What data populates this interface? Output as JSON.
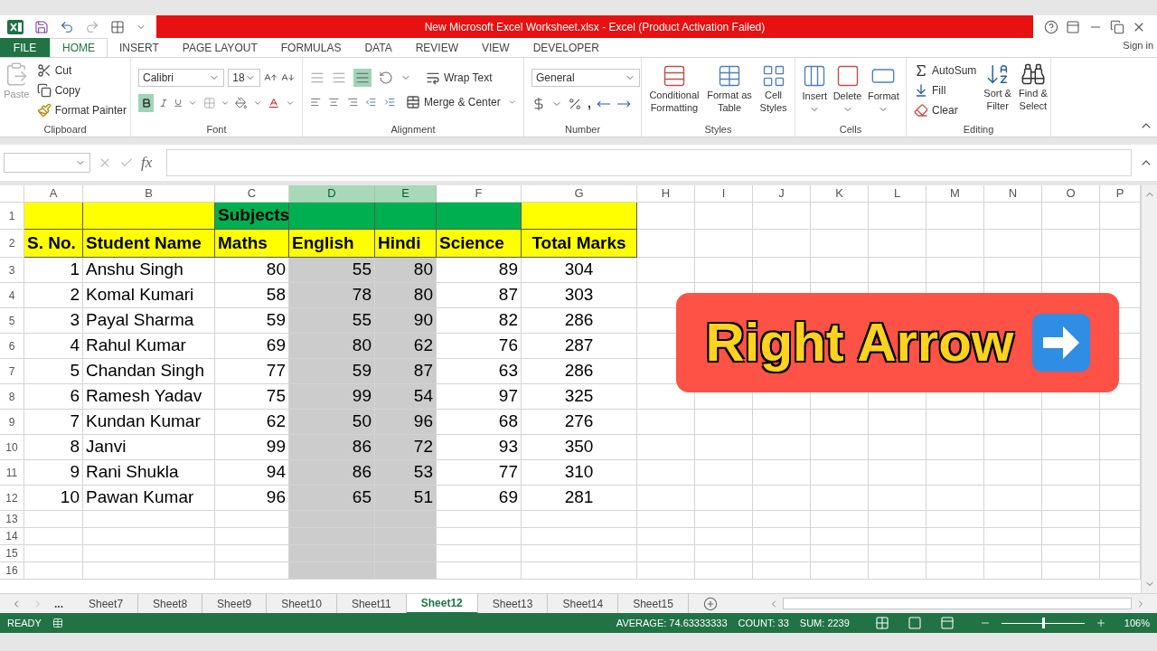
{
  "title_bar": {
    "title": "New Microsoft Excel Worksheet.xlsx -  Excel (Product Activation Failed)"
  },
  "ribbon_tabs": [
    {
      "label": "FILE",
      "kind": "file",
      "selected": false
    },
    {
      "label": "HOME",
      "kind": "tab",
      "selected": true
    },
    {
      "label": "INSERT",
      "kind": "tab",
      "selected": false
    },
    {
      "label": "PAGE LAYOUT",
      "kind": "tab",
      "selected": false
    },
    {
      "label": "FORMULAS",
      "kind": "tab",
      "selected": false
    },
    {
      "label": "DATA",
      "kind": "tab",
      "selected": false
    },
    {
      "label": "REVIEW",
      "kind": "tab",
      "selected": false
    },
    {
      "label": "VIEW",
      "kind": "tab",
      "selected": false
    },
    {
      "label": "DEVELOPER",
      "kind": "tab",
      "selected": false
    }
  ],
  "sign_in": "Sign in",
  "clipboard": {
    "label": "Clipboard",
    "paste": "Paste",
    "cut": "Cut",
    "copy": "Copy",
    "format_painter": "Format Painter"
  },
  "font": {
    "label": "Font",
    "font_name": "Calibri",
    "font_size": "18",
    "bold": true
  },
  "alignment": {
    "label": "Alignment",
    "wrap_text": "Wrap Text",
    "merge": "Merge & Center",
    "bottom_align": true
  },
  "number": {
    "label": "Number",
    "format": "General",
    "comma": ","
  },
  "styles": {
    "label": "Styles",
    "buttons": [
      {
        "lines": [
          "Conditional",
          "Formatting"
        ],
        "kind": "conditional"
      },
      {
        "lines": [
          "Format as",
          "Table"
        ],
        "kind": "table"
      },
      {
        "lines": [
          "Cell",
          "Styles"
        ],
        "kind": "cellstyles"
      }
    ]
  },
  "cells": {
    "label": "Cells",
    "buttons": [
      {
        "label": "Insert",
        "kind": "insert"
      },
      {
        "label": "Delete",
        "kind": "delete"
      },
      {
        "label": "Format",
        "kind": "format"
      }
    ]
  },
  "editing": {
    "label": "Editing",
    "autosum": "AutoSum",
    "fill": "Fill",
    "clear": "Clear",
    "sort": [
      "Sort &",
      "Filter"
    ],
    "find": [
      "Find &",
      "Select"
    ]
  },
  "formula_bar": {
    "fx": "fx"
  },
  "columns": [
    {
      "letter": "A",
      "selected": false
    },
    {
      "letter": "B",
      "selected": false
    },
    {
      "letter": "C",
      "selected": false
    },
    {
      "letter": "D",
      "selected": true
    },
    {
      "letter": "E",
      "selected": true
    },
    {
      "letter": "F",
      "selected": false
    },
    {
      "letter": "G",
      "selected": false
    },
    {
      "letter": "H",
      "selected": false
    },
    {
      "letter": "I",
      "selected": false
    },
    {
      "letter": "J",
      "selected": false
    },
    {
      "letter": "K",
      "selected": false
    },
    {
      "letter": "L",
      "selected": false
    },
    {
      "letter": "M",
      "selected": false
    },
    {
      "letter": "N",
      "selected": false
    },
    {
      "letter": "O",
      "selected": false
    },
    {
      "letter": "P",
      "selected": false
    }
  ],
  "rows": [
    {
      "number": "1",
      "kind": "title",
      "cells": [
        {
          "text": "",
          "color": "#ffff00"
        },
        {
          "text": "",
          "color": "#ffff00"
        },
        {
          "text": "Subjects",
          "color": "#00b050"
        },
        {
          "text": "",
          "color": "#00b050"
        },
        {
          "text": "",
          "color": "#00b050"
        },
        {
          "text": "",
          "color": "#00b050"
        },
        {
          "text": "",
          "color": "#ffff00"
        }
      ]
    },
    {
      "number": "2",
      "kind": "header",
      "cells": [
        {
          "text": "S. No.",
          "color": "#ffff00"
        },
        {
          "text": "Student Name",
          "color": "#ffff00"
        },
        {
          "text": "Maths",
          "color": "#ffff00"
        },
        {
          "text": "English",
          "color": "#ffff00"
        },
        {
          "text": "Hindi",
          "color": "#ffff00"
        },
        {
          "text": "Science",
          "color": "#ffff00"
        },
        {
          "text": "Total Marks",
          "color": "#ffff00"
        }
      ]
    },
    {
      "number": "3",
      "kind": "data",
      "cells": [
        "1",
        "Anshu Singh",
        "80",
        "55",
        "80",
        "89",
        "304"
      ]
    },
    {
      "number": "4",
      "kind": "data",
      "cells": [
        "2",
        "Komal Kumari",
        "58",
        "78",
        "80",
        "87",
        "303"
      ]
    },
    {
      "number": "5",
      "kind": "data",
      "cells": [
        "3",
        "Payal Sharma",
        "59",
        "55",
        "90",
        "82",
        "286"
      ]
    },
    {
      "number": "6",
      "kind": "data",
      "cells": [
        "4",
        "Rahul Kumar",
        "69",
        "80",
        "62",
        "76",
        "287"
      ]
    },
    {
      "number": "7",
      "kind": "data",
      "cells": [
        "5",
        "Chandan Singh",
        "77",
        "59",
        "87",
        "63",
        "286"
      ]
    },
    {
      "number": "8",
      "kind": "data",
      "cells": [
        "6",
        "Ramesh Yadav",
        "75",
        "99",
        "54",
        "97",
        "325"
      ]
    },
    {
      "number": "9",
      "kind": "data",
      "cells": [
        "7",
        "Kundan Kumar",
        "62",
        "50",
        "96",
        "68",
        "276"
      ]
    },
    {
      "number": "10",
      "kind": "data",
      "cells": [
        "8",
        "Janvi",
        "99",
        "86",
        "72",
        "93",
        "350"
      ]
    },
    {
      "number": "11",
      "kind": "data",
      "cells": [
        "9",
        "Rani Shukla",
        "94",
        "86",
        "53",
        "77",
        "310"
      ]
    },
    {
      "number": "12",
      "kind": "data",
      "cells": [
        "10",
        "Pawan Kumar",
        "96",
        "65",
        "51",
        "69",
        "281"
      ]
    },
    {
      "number": "13",
      "kind": "empty",
      "cells": []
    },
    {
      "number": "14",
      "kind": "empty",
      "cells": []
    },
    {
      "number": "15",
      "kind": "empty",
      "cells": []
    },
    {
      "number": "16",
      "kind": "empty",
      "cells": []
    }
  ],
  "banner": {
    "text": "Right Arrow"
  },
  "sheet_more": "...",
  "sheet_tabs": [
    {
      "label": "Sheet7",
      "selected": false
    },
    {
      "label": "Sheet8",
      "selected": false
    },
    {
      "label": "Sheet9",
      "selected": false
    },
    {
      "label": "Sheet10",
      "selected": false
    },
    {
      "label": "Sheet11",
      "selected": false
    },
    {
      "label": "Sheet12",
      "selected": true
    },
    {
      "label": "Sheet13",
      "selected": false
    },
    {
      "label": "Sheet14",
      "selected": false
    },
    {
      "label": "Sheet15",
      "selected": false
    }
  ],
  "status_bar": {
    "ready": "READY",
    "average": "AVERAGE: 74.63333333",
    "count": "COUNT: 33",
    "sum": "SUM: 2239",
    "zoom": "106%",
    "zoom_slider": {
      "level": 0.49
    }
  }
}
